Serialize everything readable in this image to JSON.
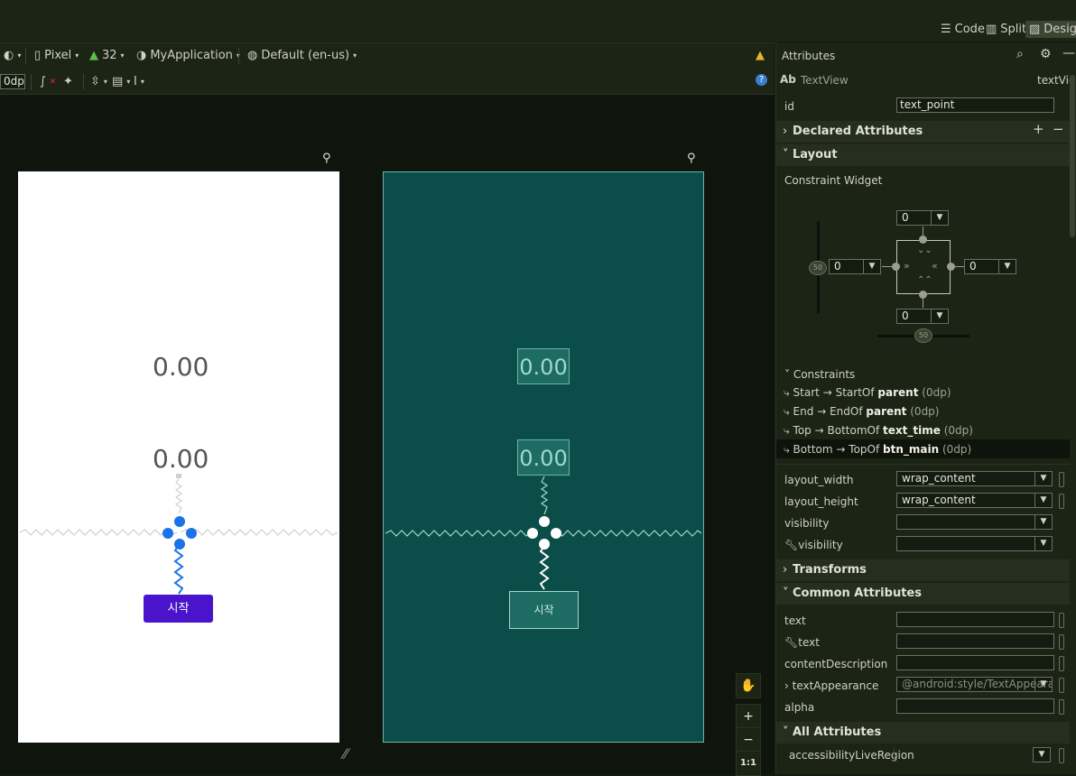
{
  "modes": {
    "code": "Code",
    "split": "Split",
    "design": "Design"
  },
  "toolbar": {
    "device": "Pixel",
    "api": "32",
    "theme": "MyApplication",
    "locale": "Default (en-us)",
    "margin": "0dp"
  },
  "phone": {
    "text_time": "0.00",
    "text_point": "0.00",
    "button": "시작"
  },
  "blueprint": {
    "text_time": "0.00",
    "text_point": "0.00",
    "button": "시작"
  },
  "zoom": {
    "fit": "1:1"
  },
  "attributes": {
    "title": "Attributes",
    "widget_type": "TextView",
    "widget_id_label": "textView",
    "id_label": "id",
    "id_value": "text_point",
    "declared": "Declared Attributes",
    "layout": "Layout",
    "constraint_widget": "Constraint Widget",
    "margin_top": "0",
    "margin_left": "0",
    "margin_right": "0",
    "margin_bottom": "0",
    "bias_v": "50",
    "bias_h": "50",
    "constraints_title": "Constraints",
    "constraints": [
      {
        "side": "Start",
        "arrow": "→",
        "target": "StartOf",
        "ref": "parent",
        "margin": "(0dp)"
      },
      {
        "side": "End",
        "arrow": "→",
        "target": "EndOf",
        "ref": "parent",
        "margin": "(0dp)"
      },
      {
        "side": "Top",
        "arrow": "→",
        "target": "BottomOf",
        "ref": "text_time",
        "margin": "(0dp)"
      },
      {
        "side": "Bottom",
        "arrow": "→",
        "target": "TopOf",
        "ref": "btn_main",
        "margin": "(0dp)"
      }
    ],
    "layout_width_label": "layout_width",
    "layout_width": "wrap_content",
    "layout_height_label": "layout_height",
    "layout_height": "wrap_content",
    "visibility_label": "visibility",
    "visibility_tools_label": "visibility",
    "transforms": "Transforms",
    "common": "Common Attributes",
    "text_label": "text",
    "text_tools_label": "text",
    "content_desc_label": "contentDescription",
    "text_appearance_label": "textAppearance",
    "text_appearance": "@android:style/TextAppearance",
    "alpha_label": "alpha",
    "all_attributes": "All Attributes",
    "accessibility": "accessibilityLiveRegion"
  },
  "colors": {
    "accent": "#4a14cc",
    "blueprint": "#0b4d48",
    "constraint": "#1a73e8"
  }
}
